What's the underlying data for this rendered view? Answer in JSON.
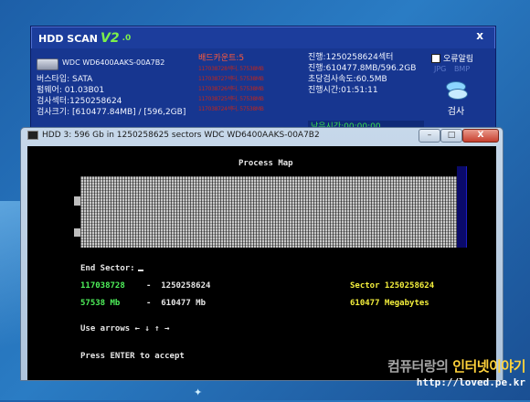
{
  "desktop": {
    "sparkle": "✦"
  },
  "hdd_scan": {
    "title": "HDD SCAN",
    "version_main": "V2",
    "version_sub": ".0",
    "close_label": "x",
    "model": "WDC WD6400AAKS-00A7B2",
    "info_lines": [
      "버스타입: SATA",
      "펌웨어: 01.03B01",
      "검사섹터:1250258624",
      "검사크기: [610477.84MB] / [596,2GB]"
    ],
    "bad_count_label": "배드카운트:5",
    "bad_rows": [
      "117038728섹터, 57538MB",
      "117038727섹터, 57538MB",
      "117038726섹터, 57538MB",
      "117038725섹터, 57538MB",
      "117038724섹터, 57538MB"
    ],
    "progress_lines": [
      "진행:1250258624섹터",
      "진행:610477.8MB/596.2GB",
      "초당검사속도:60.5MB",
      "진행시간:01:51:11"
    ],
    "remaining_time": "남은시간:00:00:00",
    "alert_checkbox_label": "오류알림",
    "format_options": [
      "JPG",
      "BMP"
    ],
    "scan_button_label": "검사"
  },
  "console": {
    "title": "HDD 3: 596 Gb in 1250258625 sectors  WDC WD6400AAKS-00A7B2",
    "buttons": {
      "minimize": "–",
      "maximize": "□",
      "close": "X"
    },
    "process_map_title": "Process Map",
    "end_sector_label": "End Sector:",
    "row1_left": "117038728",
    "row1_mid": "-  1250258624",
    "row1_right": "Sector 1250258624",
    "row2_left": "57538 Mb",
    "row2_mid": "-  610477 Mb",
    "row2_right": "610477 Megabytes",
    "arrows_hint": "Use arrows ← ↓ ↑ →",
    "enter_hint": "Press ENTER to accept"
  },
  "watermark": {
    "line1_a": "컴퓨터랑의 ",
    "line1_b": "인터넷이야기",
    "line2": "http://loved.pe.kr"
  }
}
